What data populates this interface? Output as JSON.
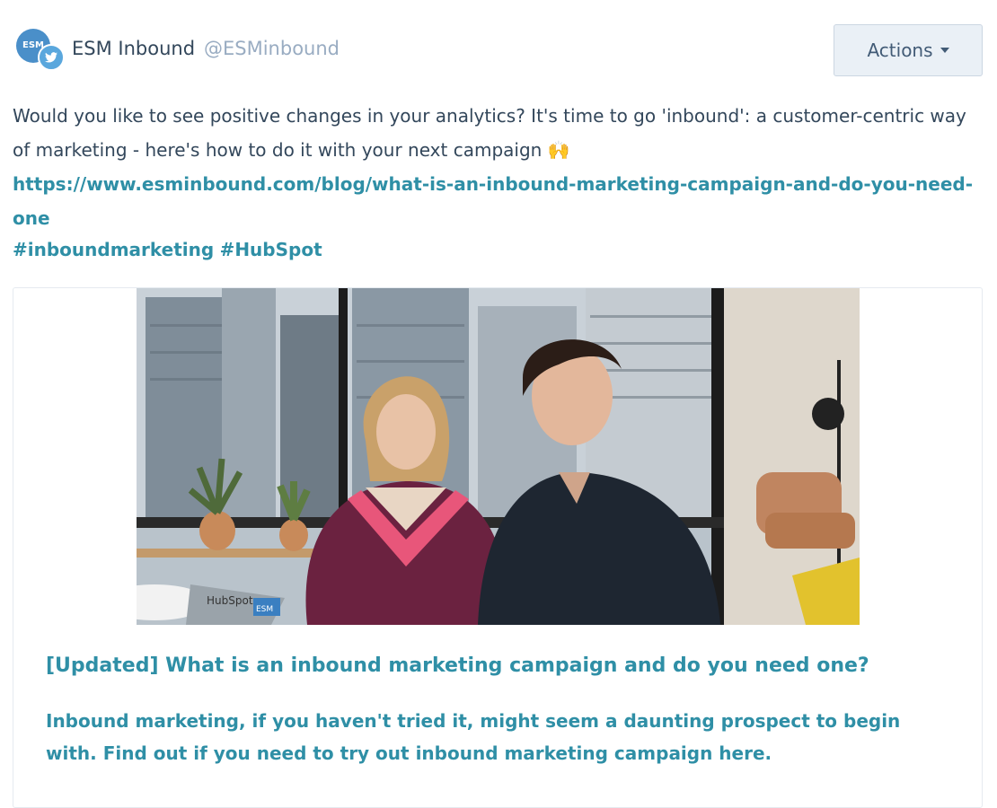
{
  "account": {
    "avatar_text": "ESM",
    "name": "ESM Inbound",
    "handle": "@ESMinbound"
  },
  "actions_button": {
    "label": "Actions"
  },
  "post": {
    "text": "Would you like to see positive changes in your analytics? It's time to go 'inbound': a customer-centric way of marketing - here's how to do it with your next campaign 🙌 ",
    "link": "https://www.esminbound.com/blog/what-is-an-inbound-marketing-campaign-and-do-you-need-one",
    "hashtags": [
      "#inboundmarketing",
      "#HubSpot"
    ]
  },
  "link_preview": {
    "title": "[Updated] What is an inbound marketing campaign and do you need one?",
    "description": "Inbound marketing, if you haven't tried it, might seem a daunting prospect to begin with. Find out if you need to try out inbound marketing campaign here.",
    "laptop_sticker_text": "HubSpot",
    "laptop_badge_text": "ESM"
  },
  "colors": {
    "link": "#2f8fa6",
    "text": "#33475b",
    "handle": "#99acc2",
    "button_bg": "#eaf0f6",
    "twitter": "#5aa7dd"
  },
  "icons": [
    "twitter-icon",
    "chevron-down-icon"
  ]
}
